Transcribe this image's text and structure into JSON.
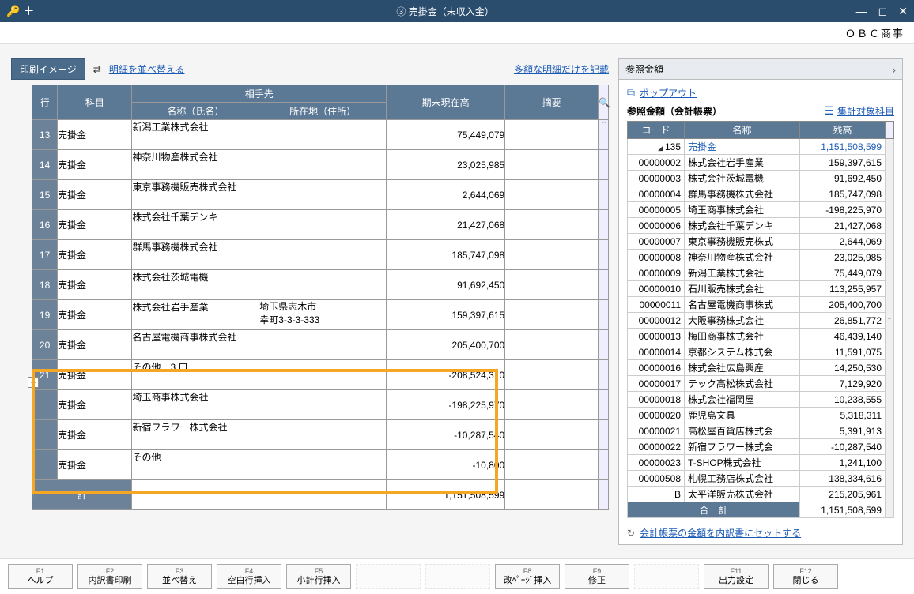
{
  "window": {
    "title": "③ 売掛金（未収入金）",
    "search_glyph": "🔑",
    "plus_glyph": "＋"
  },
  "company": "ＯＢＣ商事",
  "toolbar": {
    "print_image": "印刷イメージ",
    "sort_link": "明細を並べ替える",
    "large_only": "多額な明細だけを記載"
  },
  "main_table": {
    "headers": {
      "row": "行",
      "subject": "科目",
      "partner": "相手先",
      "name": "名称（氏名）",
      "address": "所在地（住所）",
      "balance": "期末現在高",
      "memo": "摘要"
    },
    "rows": [
      {
        "no": "13",
        "subject": "売掛金",
        "name": "新潟工業株式会社",
        "address": "",
        "balance": "75,449,079"
      },
      {
        "no": "14",
        "subject": "売掛金",
        "name": "神奈川物産株式会社",
        "address": "",
        "balance": "23,025,985"
      },
      {
        "no": "15",
        "subject": "売掛金",
        "name": "東京事務機販売株式会社",
        "address": "",
        "balance": "2,644,069"
      },
      {
        "no": "16",
        "subject": "売掛金",
        "name": "株式会社千葉デンキ",
        "address": "",
        "balance": "21,427,068"
      },
      {
        "no": "17",
        "subject": "売掛金",
        "name": "群馬事務機株式会社",
        "address": "",
        "balance": "185,747,098"
      },
      {
        "no": "18",
        "subject": "売掛金",
        "name": "株式会社茨城電機",
        "address": "",
        "balance": "91,692,450"
      },
      {
        "no": "19",
        "subject": "売掛金",
        "name": "株式会社岩手産業",
        "address": "埼玉県志木市\n幸町3-3-3-333",
        "balance": "159,397,615"
      },
      {
        "no": "20",
        "subject": "売掛金",
        "name": "名古屋電機商事株式会社",
        "address": "",
        "balance": "205,400,700"
      },
      {
        "no": "21",
        "subject": "売掛金",
        "name": "その他　3 口",
        "address": "",
        "balance": "-208,524,310"
      },
      {
        "no": "",
        "subject": "売掛金",
        "name": "埼玉商事株式会社",
        "address": "",
        "balance": "-198,225,970"
      },
      {
        "no": "",
        "subject": "売掛金",
        "name": "新宿フラワー株式会社",
        "address": "",
        "balance": "-10,287,540"
      },
      {
        "no": "",
        "subject": "売掛金",
        "name": "その他",
        "address": "",
        "balance": "-10,800"
      }
    ],
    "sum_label": "計",
    "sum_value": "1,151,508,599"
  },
  "side": {
    "title": "参照金額",
    "popout": "ポップアウト",
    "sub_title": "参照金額（会計帳票）",
    "target_link": "集計対象科目",
    "headers": {
      "code": "コード",
      "name": "名称",
      "balance": "残高"
    },
    "active_code": "135",
    "active_name": "売掛金",
    "active_balance": "1,151,508,599",
    "rows": [
      {
        "code": "00000002",
        "name": "株式会社岩手産業",
        "bal": "159,397,615"
      },
      {
        "code": "00000003",
        "name": "株式会社茨城電機",
        "bal": "91,692,450"
      },
      {
        "code": "00000004",
        "name": "群馬事務機株式会社",
        "bal": "185,747,098"
      },
      {
        "code": "00000005",
        "name": "埼玉商事株式会社",
        "bal": "-198,225,970"
      },
      {
        "code": "00000006",
        "name": "株式会社千葉デンキ",
        "bal": "21,427,068"
      },
      {
        "code": "00000007",
        "name": "東京事務機販売株式",
        "bal": "2,644,069"
      },
      {
        "code": "00000008",
        "name": "神奈川物産株式会社",
        "bal": "23,025,985"
      },
      {
        "code": "00000009",
        "name": "新潟工業株式会社",
        "bal": "75,449,079"
      },
      {
        "code": "00000010",
        "name": "石川販売株式会社",
        "bal": "113,255,957"
      },
      {
        "code": "00000011",
        "name": "名古屋電機商事株式",
        "bal": "205,400,700"
      },
      {
        "code": "00000012",
        "name": "大阪事務株式会社",
        "bal": "26,851,772"
      },
      {
        "code": "00000013",
        "name": "梅田商事株式会社",
        "bal": "46,439,140"
      },
      {
        "code": "00000014",
        "name": "京都システム株式会",
        "bal": "11,591,075"
      },
      {
        "code": "00000016",
        "name": "株式会社広島興産",
        "bal": "14,250,530"
      },
      {
        "code": "00000017",
        "name": "テック高松株式会社",
        "bal": "7,129,920"
      },
      {
        "code": "00000018",
        "name": "株式会社福岡屋",
        "bal": "10,238,555"
      },
      {
        "code": "00000020",
        "name": "鹿児島文具",
        "bal": "5,318,311"
      },
      {
        "code": "00000021",
        "name": "高松屋百貨店株式会",
        "bal": "5,391,913"
      },
      {
        "code": "00000022",
        "name": "新宿フラワー株式会",
        "bal": "-10,287,540"
      },
      {
        "code": "00000023",
        "name": "T-SHOP株式会社",
        "bal": "1,241,100"
      },
      {
        "code": "00000508",
        "name": "札幌工務店株式会社",
        "bal": "138,334,616"
      },
      {
        "code": "B",
        "name": "太平洋販売株式会社",
        "bal": "215,205,961"
      }
    ],
    "total_label": "合　計",
    "total_value": "1,151,508,599",
    "set_link": "会計帳票の金額を内訳書にセットする"
  },
  "fkeys": {
    "f1": {
      "k": "F1",
      "l": "ヘルプ"
    },
    "f2": {
      "k": "F2",
      "l": "内訳書印刷"
    },
    "f3": {
      "k": "F3",
      "l": "並べ替え"
    },
    "f4": {
      "k": "F4",
      "l": "空白行挿入"
    },
    "f5": {
      "k": "F5",
      "l": "小計行挿入"
    },
    "f8": {
      "k": "F8",
      "l": "改ﾍﾟｰｼﾞ挿入"
    },
    "f9": {
      "k": "F9",
      "l": "修正"
    },
    "f11": {
      "k": "F11",
      "l": "出力設定"
    },
    "f12": {
      "k": "F12",
      "l": "閉じる"
    }
  },
  "collapse_glyph": "−"
}
